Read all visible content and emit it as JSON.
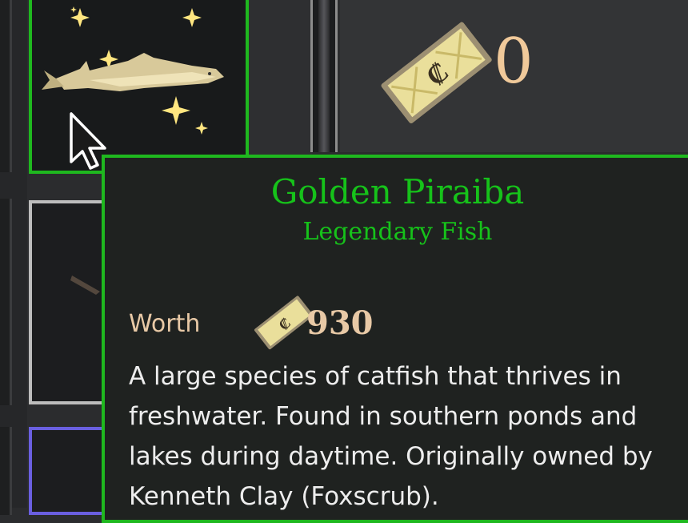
{
  "inventory": {
    "currency_count": "0",
    "currency_icon": "coin-bill-icon",
    "selected_item_icon": "golden-fish-icon"
  },
  "tooltip": {
    "name": "Golden Piraiba",
    "rarity": "Legendary Fish",
    "worth_label": "Worth",
    "worth_value": "930",
    "description": "A large species of catfish that thrives in freshwater. Found in southern ponds and lakes during daytime. Originally owned by Kenneth Clay (Foxscrub).",
    "accent_color": "#16c21a",
    "text_color": "#ededed",
    "worth_color": "#e8c9a6"
  }
}
